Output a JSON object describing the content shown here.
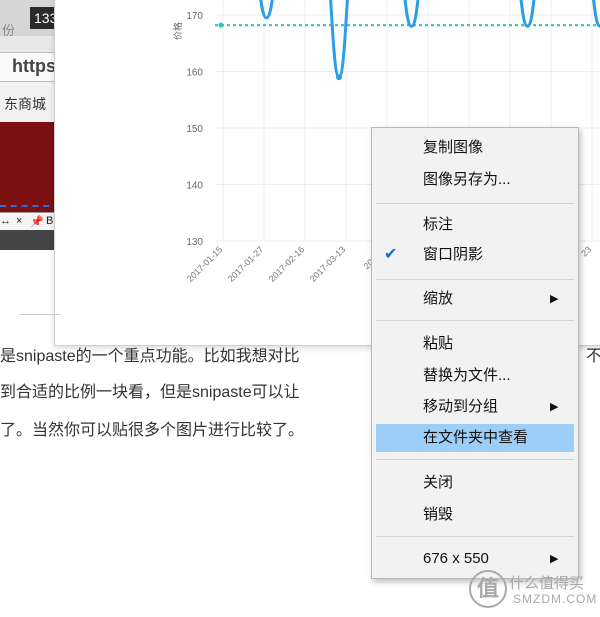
{
  "left_screenshot": {
    "counter": "133",
    "partial_char": "份",
    "url_fragment": "https",
    "nav_fragment": "东商城",
    "toolbar_glyphs": [
      "↔",
      "×",
      "📌",
      "B"
    ]
  },
  "chart_data": {
    "type": "line",
    "ylabel": "价格",
    "y_ticks": [
      130,
      140,
      150,
      160,
      170
    ],
    "ylim": [
      130,
      173
    ],
    "x_ticks": [
      "2017-01-15",
      "2017-01-27",
      "2017-02-16",
      "2017-03-13",
      "2017-0",
      "",
      "",
      "",
      "",
      "23"
    ],
    "reference_line": {
      "value": 168.2,
      "color": "#33c6b8",
      "style": "dotted"
    },
    "series": [
      {
        "color": "#2b9ee8",
        "x": [
          1,
          2,
          3,
          4,
          5,
          6,
          7,
          8,
          9,
          10,
          11,
          12,
          13,
          14,
          15,
          16,
          17,
          18,
          19,
          20,
          21,
          22,
          23,
          24,
          25,
          26,
          27,
          28,
          29,
          30
        ],
        "y": [
          180,
          180,
          180,
          169.5,
          180,
          180,
          180,
          180,
          159,
          180,
          180,
          180,
          180,
          168,
          180,
          180,
          180,
          180,
          180,
          180,
          180,
          168,
          180,
          180,
          180,
          180,
          168,
          180,
          180,
          180
        ]
      }
    ],
    "series_color": "#2b9ee8"
  },
  "article": {
    "lines": [
      "是snipaste的一个重点功能。比如我想对比",
      "到合适的比例一块看，但是snipaste可以让",
      "了。当然你可以贴很多个图片进行比较了。"
    ],
    "right_fragment": "不"
  },
  "context_menu": {
    "items": [
      {
        "label": "复制图像"
      },
      {
        "label": "图像另存为..."
      },
      {
        "label": "标注"
      },
      {
        "label": "窗口阴影",
        "checked": true
      },
      {
        "label": "缩放",
        "submenu": true
      },
      {
        "label": "粘贴"
      },
      {
        "label": "替换为文件..."
      },
      {
        "label": "移动到分组",
        "submenu": true
      },
      {
        "label": "在文件夹中查看",
        "highlighted": true
      },
      {
        "label": "关闭"
      },
      {
        "label": "销毁"
      },
      {
        "label": "676 x 550",
        "submenu": true
      }
    ],
    "arrow_glyph": "▶",
    "check_glyph": "✔",
    "highlight_color": "#9ccef7"
  },
  "watermark": {
    "logo_char": "值",
    "title": "什么值得买",
    "subtitle": "SMZDM.COM"
  }
}
